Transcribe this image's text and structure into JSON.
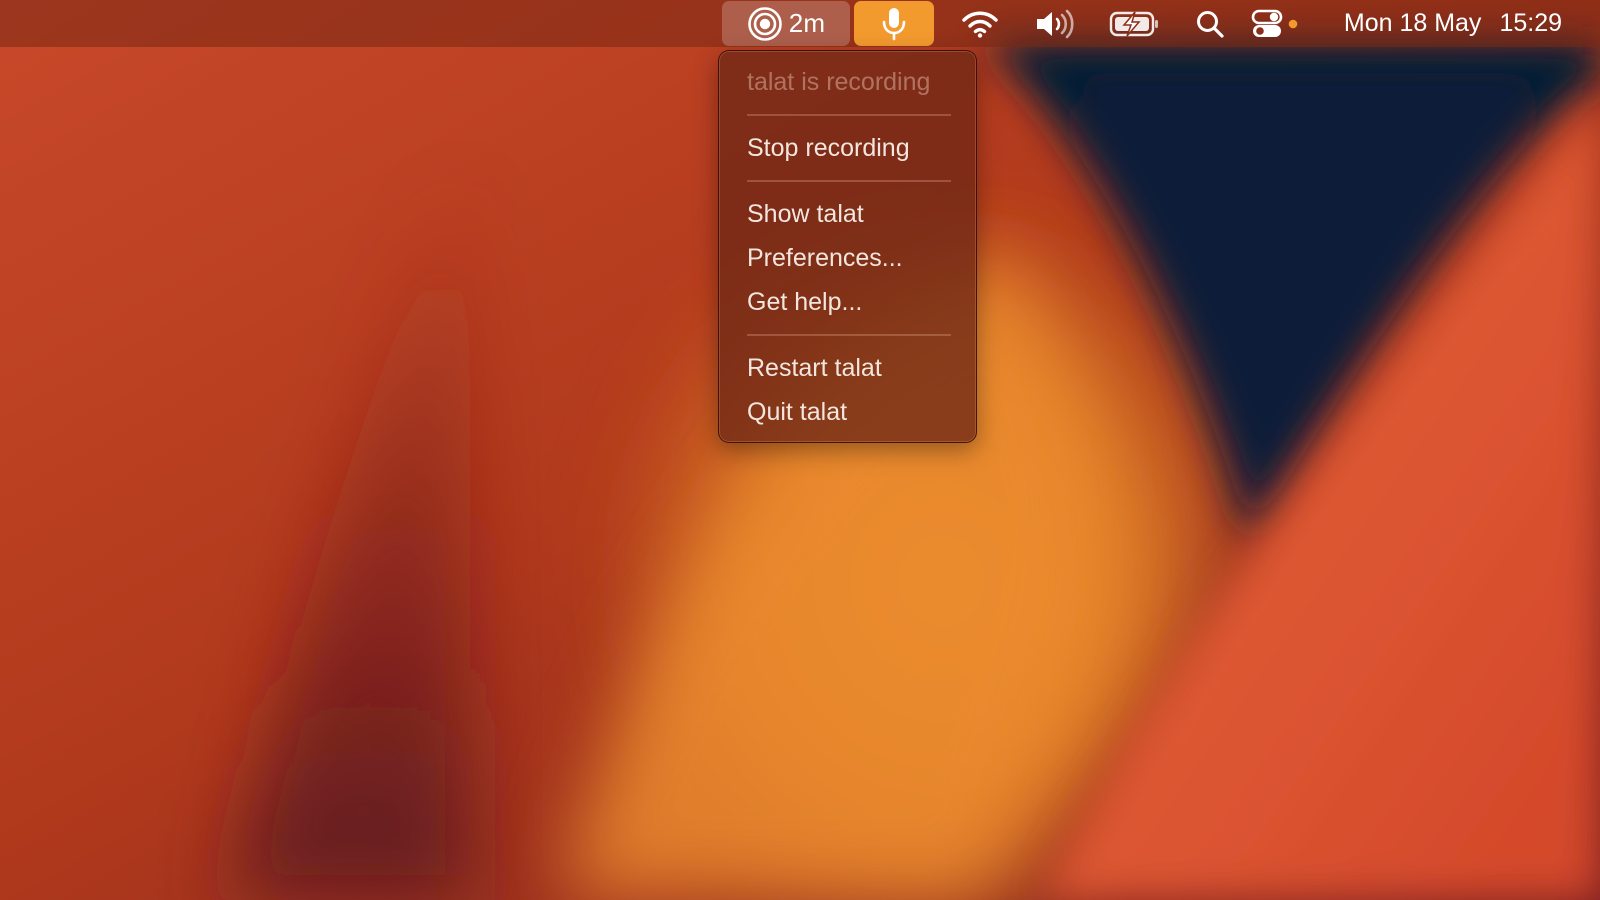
{
  "menubar": {
    "recording_indicator": {
      "icon": "record-target-icon",
      "label": "2m"
    },
    "mic_button": {
      "icon": "microphone-icon",
      "color": "#f39a2f"
    },
    "status_icons": [
      "wifi-icon",
      "volume-icon",
      "battery-charging-icon",
      "search-icon",
      "control-center-icon"
    ],
    "control_center_dot_color": "#f39a2f",
    "clock": {
      "date": "Mon 18 May",
      "time": "15:29"
    }
  },
  "menu": {
    "header": "talat is recording",
    "items": [
      {
        "label": "Stop recording"
      },
      {
        "label": "Show talat"
      },
      {
        "label": "Preferences..."
      },
      {
        "label": "Get help..."
      },
      {
        "label": "Restart talat"
      },
      {
        "label": "Quit talat"
      }
    ]
  },
  "colors": {
    "accent": "#f39a2f",
    "wallpaper_dark": "#061a34",
    "wallpaper_orange": "#ee8a2c",
    "wallpaper_red": "#c2431f"
  }
}
